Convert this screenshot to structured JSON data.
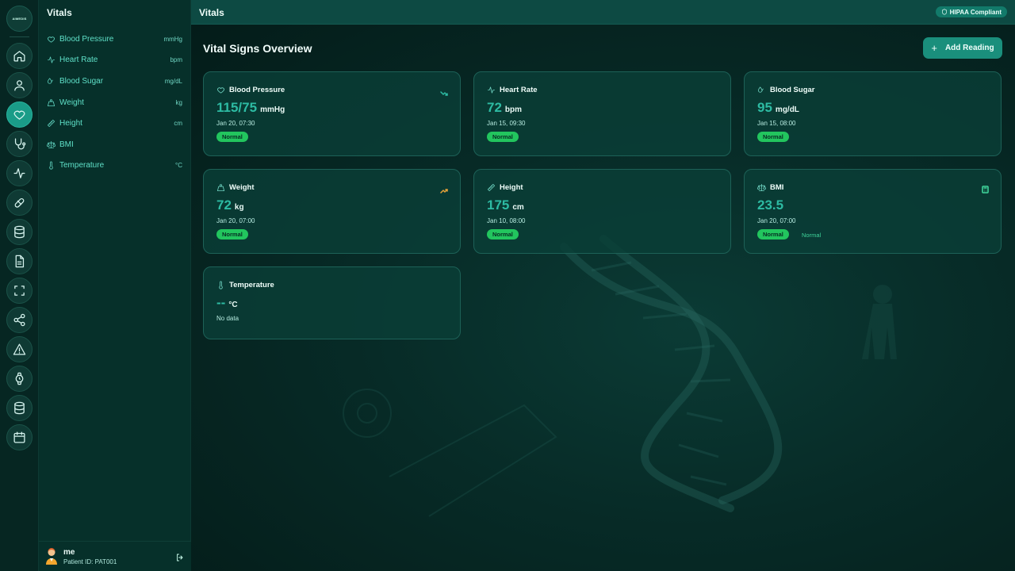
{
  "rail": {
    "logo_text": "AIMEDIS",
    "items": [
      {
        "icon": "home-icon"
      },
      {
        "icon": "user-icon"
      },
      {
        "icon": "heart-icon",
        "active": true
      },
      {
        "icon": "stethoscope-icon"
      },
      {
        "icon": "activity-icon"
      },
      {
        "icon": "pill-icon"
      },
      {
        "icon": "database-icon"
      },
      {
        "icon": "document-icon"
      },
      {
        "icon": "scan-icon"
      },
      {
        "icon": "share-icon"
      },
      {
        "icon": "alert-icon"
      },
      {
        "icon": "watch-icon"
      },
      {
        "icon": "database-icon"
      },
      {
        "icon": "calendar-icon"
      }
    ]
  },
  "sidebar": {
    "title": "Vitals",
    "items": [
      {
        "label": "Blood Pressure",
        "unit": "mmHg",
        "icon": "heart-icon"
      },
      {
        "label": "Heart Rate",
        "unit": "bpm",
        "icon": "activity-icon"
      },
      {
        "label": "Blood Sugar",
        "unit": "mg/dL",
        "icon": "droplets-icon"
      },
      {
        "label": "Weight",
        "unit": "kg",
        "icon": "weight-icon"
      },
      {
        "label": "Height",
        "unit": "cm",
        "icon": "ruler-icon"
      },
      {
        "label": "BMI",
        "unit": "",
        "icon": "scale-icon"
      },
      {
        "label": "Temperature",
        "unit": "°C",
        "icon": "thermometer-icon"
      }
    ],
    "user": {
      "name": "me",
      "patient_id": "Patient ID: PAT001"
    }
  },
  "header": {
    "title": "Vitals",
    "compliance_badge": "HIPAA Compliant"
  },
  "main": {
    "page_title": "Vital Signs Overview",
    "add_button": "Add Reading",
    "cards": [
      {
        "name": "Blood Pressure",
        "value": "115/75",
        "unit": "mmHg",
        "date": "Jan 20, 07:30",
        "status": "Normal",
        "trend": "down",
        "icon": "heart-icon"
      },
      {
        "name": "Heart Rate",
        "value": "72",
        "unit": "bpm",
        "date": "Jan 15, 09:30",
        "status": "Normal",
        "icon": "activity-icon"
      },
      {
        "name": "Blood Sugar",
        "value": "95",
        "unit": "mg/dL",
        "date": "Jan 15, 08:00",
        "status": "Normal",
        "icon": "droplets-icon"
      },
      {
        "name": "Weight",
        "value": "72",
        "unit": "kg",
        "date": "Jan 20, 07:00",
        "status": "Normal",
        "trend": "up",
        "icon": "weight-icon"
      },
      {
        "name": "Height",
        "value": "175",
        "unit": "cm",
        "date": "Jan 10, 08:00",
        "status": "Normal",
        "icon": "ruler-icon"
      },
      {
        "name": "BMI",
        "value": "23.5",
        "unit": "",
        "date": "Jan 20, 07:00",
        "status": "Normal",
        "category": "Normal",
        "icon": "scale-icon"
      },
      {
        "name": "Temperature",
        "value": "--",
        "unit": "°C",
        "nodata": "No data",
        "icon": "thermometer-icon"
      }
    ]
  },
  "colors": {
    "accent": "#1a8f7c",
    "value_text": "#2dbba3",
    "status_normal": "#22c55e",
    "trend_down": "#2dbba3",
    "trend_up": "#e8a33a"
  }
}
